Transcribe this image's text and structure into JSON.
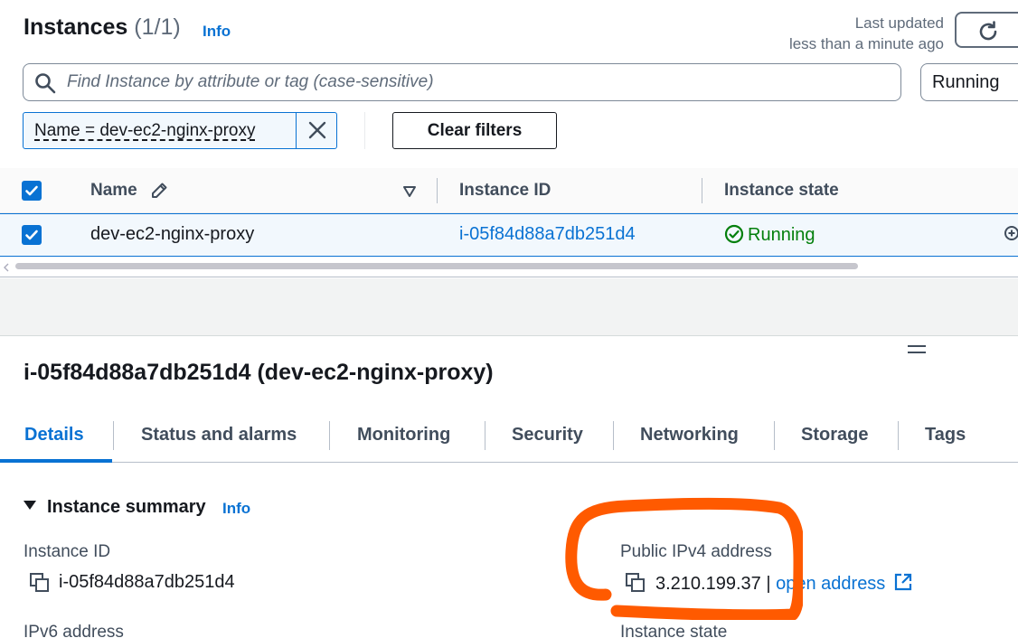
{
  "header": {
    "title": "Instances",
    "count": "(1/1)",
    "info": "Info",
    "last_updated_line1": "Last updated",
    "last_updated_line2": "less than a minute ago"
  },
  "search": {
    "placeholder": "Find Instance by attribute or tag (case-sensitive)",
    "state_filter": "Running"
  },
  "filters": {
    "token": "Name = dev-ec2-nginx-proxy",
    "clear_label": "Clear filters"
  },
  "table": {
    "columns": [
      "Name",
      "Instance ID",
      "Instance state"
    ],
    "rows": [
      {
        "name": "dev-ec2-nginx-proxy",
        "instance_id": "i-05f84d88a7db251d4",
        "state": "Running",
        "selected": true
      }
    ]
  },
  "detail": {
    "title": "i-05f84d88a7db251d4 (dev-ec2-nginx-proxy)",
    "tabs": [
      "Details",
      "Status and alarms",
      "Monitoring",
      "Security",
      "Networking",
      "Storage",
      "Tags"
    ],
    "active_tab": "Details",
    "summary": {
      "heading": "Instance summary",
      "info": "Info",
      "instance_id_label": "Instance ID",
      "instance_id_value": "i-05f84d88a7db251d4",
      "ipv6_label": "IPv6 address",
      "public_ipv4_label": "Public IPv4 address",
      "public_ipv4_value": "3.210.199.37",
      "separator": "|",
      "open_address": "open address",
      "instance_state_label": "Instance state"
    }
  },
  "colors": {
    "link": "#0972d3",
    "running": "#037f0c",
    "annotation": "#ff5a00"
  }
}
